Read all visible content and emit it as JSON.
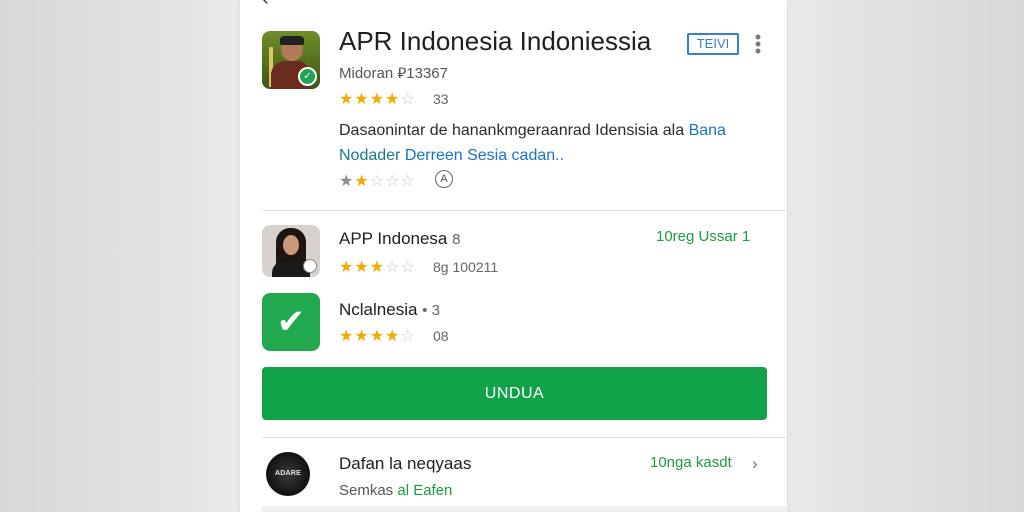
{
  "header": {
    "back_icon": "back-arrow-icon",
    "back_glyph": "‹"
  },
  "featured": {
    "title": "APR Indonesia Indoniessia",
    "tag_label": "TEIVI",
    "more_glyph": "•\n•\n•",
    "subtitle": "Midoran ⃄13367",
    "rating_stars": 4.5,
    "rating_text": "33",
    "description_part1": "Dasaonintar de hanankmgeraanrad Idensisia ala ",
    "description_link1": "Bana",
    "description_part2": "Nodader ",
    "description_link2": "Derreen Sesia cadan..",
    "secondary_rating_stars": 2,
    "info_glyph": "A"
  },
  "list": [
    {
      "name": "APP Indonesa",
      "name_suffix": "8",
      "action": "10reg Ussar 1",
      "rating_stars": 3,
      "rating_text": "8g 100211"
    },
    {
      "name": "Nclalnesia",
      "name_suffix": "• 3",
      "icon_glyph": "✔",
      "rating_stars": 4,
      "rating_text": "08"
    }
  ],
  "install_button_label": "UNDUA",
  "bottom_item": {
    "name": "Dafan la neqyaas",
    "action": "10nga kasdt",
    "chevron_glyph": "›",
    "sub_prefix": "Semkas ",
    "sub_accent": "al Eafen",
    "icon_label": "ADARE"
  },
  "colors": {
    "accent_green": "#11a149",
    "link_blue": "#1a73c8",
    "star_gold": "#f2a900"
  }
}
